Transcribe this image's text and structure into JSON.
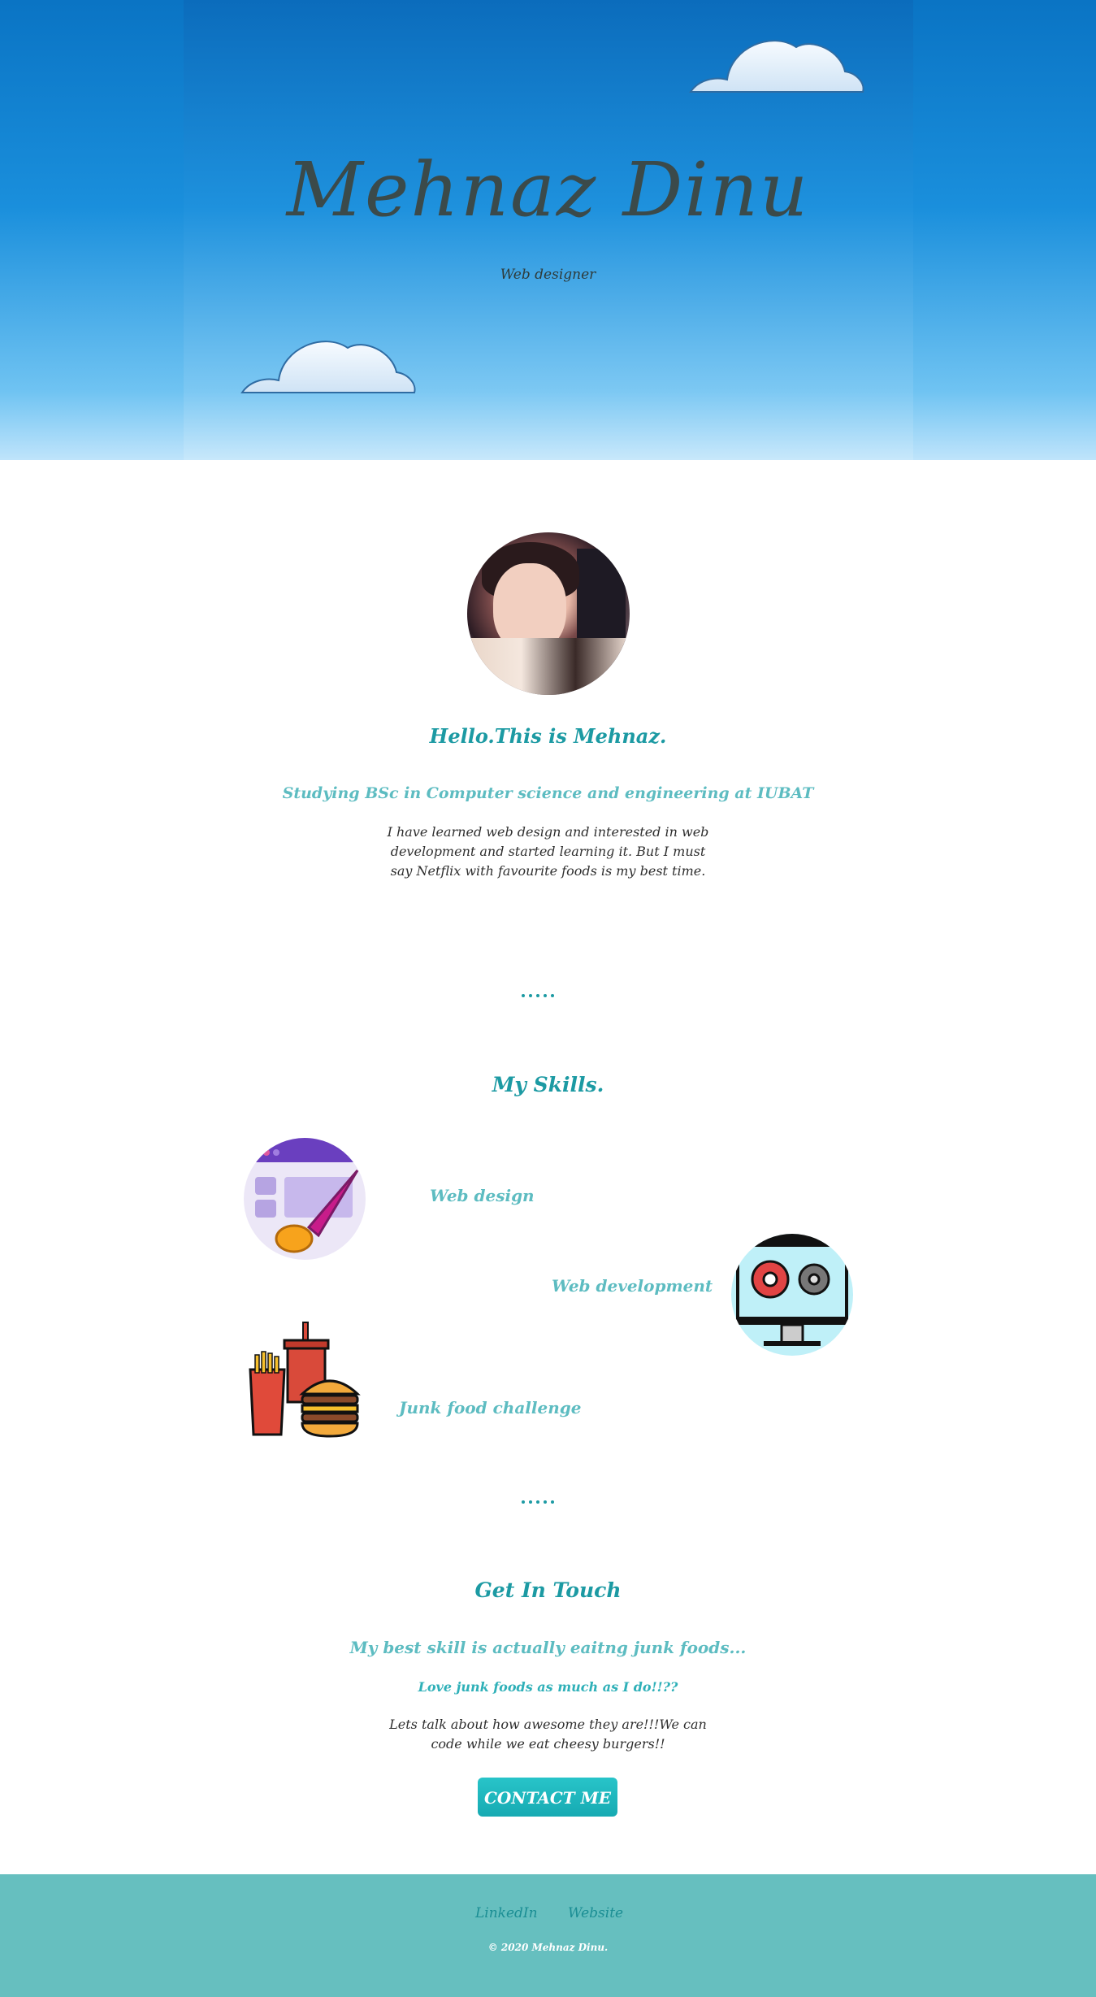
{
  "hero": {
    "name": "Mehnaz Dinu",
    "subtitle": "Web designer"
  },
  "about": {
    "greeting": "Hello.This is Mehnaz.",
    "study": "Studying BSc in Computer science and engineering at IUBAT",
    "bio_line1": "I have learned web design and interested in web",
    "bio_line2": "development and started learning it. But I must",
    "bio_line3": "say Netflix with favourite foods is my best time."
  },
  "skills": {
    "title": "My Skills.",
    "items": [
      {
        "label": "Web design",
        "icon": "paint-brush-browser-icon"
      },
      {
        "label": "Web development",
        "icon": "monitor-gears-icon"
      },
      {
        "label": "Junk food challenge",
        "icon": "burger-fries-drink-icon"
      }
    ]
  },
  "contact": {
    "title": "Get In Touch",
    "line1": "My best skill is actually eaitng junk foods...",
    "line2": "Love junk foods as much as I do!!??",
    "text1": "Lets talk about how awesome they are!!!We can",
    "text2": "code while we eat cheesy burgers!!",
    "button": "CONTACT ME"
  },
  "footer": {
    "links": [
      "LinkedIn",
      "Website"
    ],
    "copyright": "© 2020 Mehnaz Dinu."
  },
  "colors": {
    "accent": "#1c9aa3",
    "accent_light": "#5dbcc1",
    "footer_bg": "#66bfbf",
    "button": "#1fb7bd"
  }
}
